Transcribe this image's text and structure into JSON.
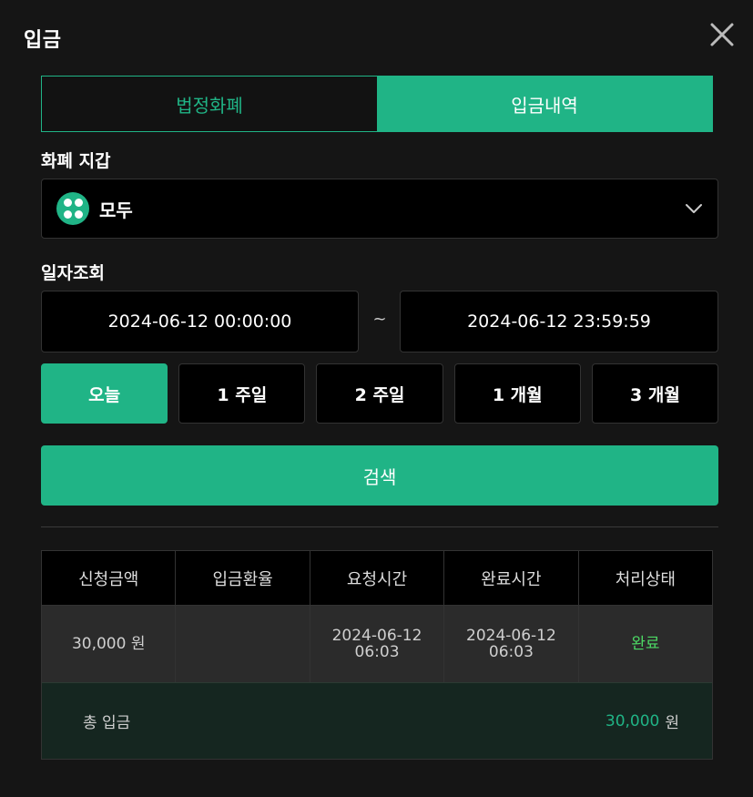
{
  "modal": {
    "title": "입금"
  },
  "tabs": [
    {
      "label": "법정화폐",
      "active": false
    },
    {
      "label": "입금내역",
      "active": true
    }
  ],
  "wallet": {
    "label": "화폐 지갑",
    "selected": "모두",
    "icon": "grid-dots-icon"
  },
  "date_range": {
    "label": "일자조회",
    "start": "2024-06-12 00:00:00",
    "separator": "~",
    "end": "2024-06-12 23:59:59"
  },
  "periods": [
    {
      "label": "오늘",
      "active": true
    },
    {
      "label": "1 주일",
      "active": false
    },
    {
      "label": "2 주일",
      "active": false
    },
    {
      "label": "1 개월",
      "active": false
    },
    {
      "label": "3 개월",
      "active": false
    }
  ],
  "search": {
    "label": "검색"
  },
  "table": {
    "headers": [
      "신청금액",
      "입금환율",
      "요청시간",
      "완료시간",
      "처리상태"
    ],
    "rows": [
      {
        "amount": "30,000 원",
        "rate": "",
        "request_date": "2024-06-12",
        "request_time": "06:03",
        "complete_date": "2024-06-12",
        "complete_time": "06:03",
        "status": "완료"
      }
    ],
    "footer": {
      "label": "총 입금",
      "amount": "30,000",
      "unit": "원"
    }
  },
  "colors": {
    "accent": "#20b486",
    "status_complete": "#4cd964",
    "background": "#151515"
  }
}
